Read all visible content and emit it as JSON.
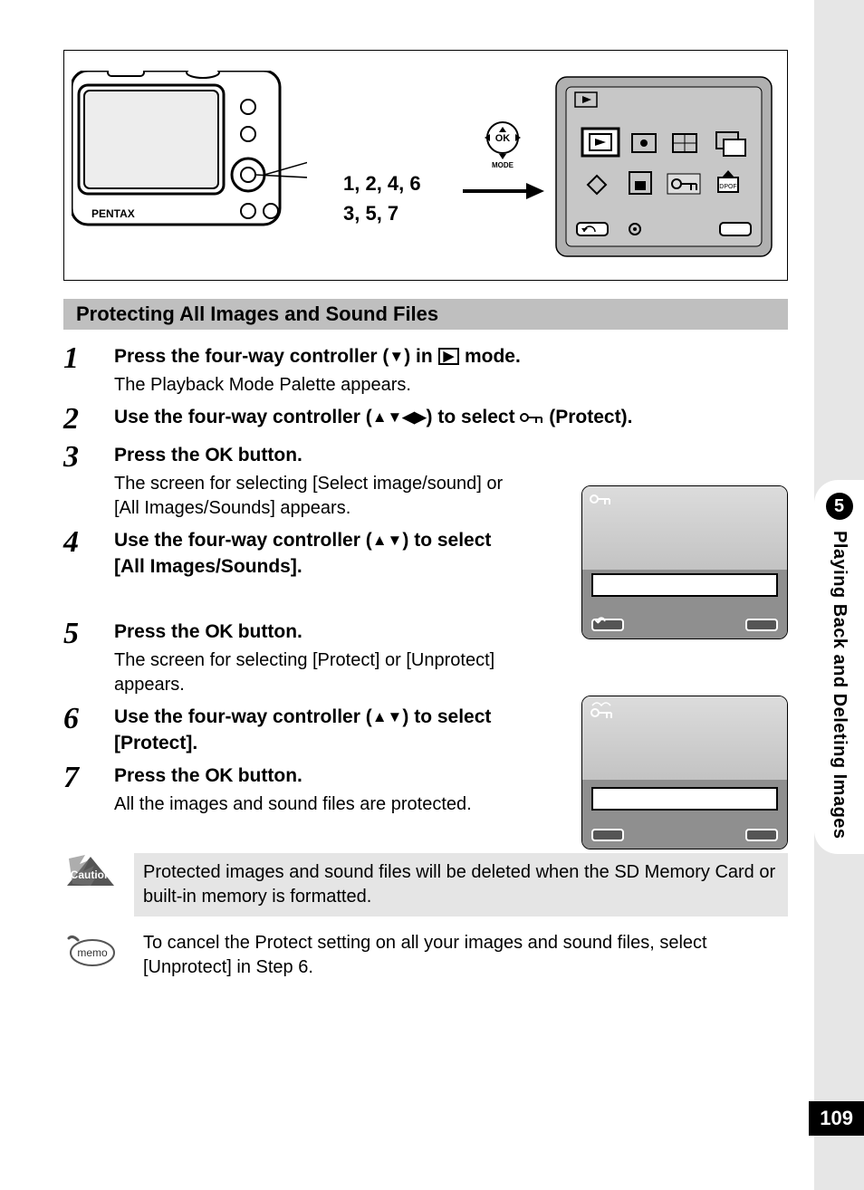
{
  "page_number": "109",
  "chapter": {
    "num": "5",
    "title": "Playing Back and Deleting Images"
  },
  "diagram": {
    "step_line1": "1, 2, 4, 6",
    "step_line2": "3, 5, 7",
    "brand": "PENTAX",
    "ok_label": "OK",
    "mode_label": "MODE"
  },
  "section_heading": "Protecting All Images and Sound Files",
  "steps": [
    {
      "n": "1",
      "title_pre": "Press the four-way controller (",
      "title_sym": "▼",
      "title_mid": ") in ",
      "title_icon": "▶",
      "title_post": " mode.",
      "desc": "The Playback Mode Palette appears."
    },
    {
      "n": "2",
      "title_pre": "Use the four-way controller (",
      "title_sym": "▲▼◀▶",
      "title_mid": ") to select ",
      "title_icon": "🔒",
      "title_post": " (Protect)."
    },
    {
      "n": "3",
      "title_pre": "Press the ",
      "title_ok": "OK",
      "title_post": " button.",
      "desc": "The screen for selecting [Select image/sound] or [All Images/Sounds] appears."
    },
    {
      "n": "4",
      "title_pre": "Use the four-way controller (",
      "title_sym": "▲▼",
      "title_post": ") to select [All Images/Sounds]."
    },
    {
      "n": "5",
      "title_pre": "Press the ",
      "title_ok": "OK",
      "title_post": " button.",
      "desc": "The screen for selecting [Protect] or [Unprotect] appears."
    },
    {
      "n": "6",
      "title_pre": "Use the four-way controller (",
      "title_sym": "▲▼",
      "title_post": ") to select [Protect]."
    },
    {
      "n": "7",
      "title_pre": "Press the ",
      "title_ok": "OK",
      "title_post": " button.",
      "desc": "All the images and sound files are protected."
    }
  ],
  "caution": {
    "label": "Caution",
    "text": "Protected images and sound files will be deleted when the SD Memory Card or built-in memory is formatted."
  },
  "memo": {
    "label": "memo",
    "text": "To cancel the Protect setting on all your images and sound files, select [Unprotect] in Step 6."
  }
}
